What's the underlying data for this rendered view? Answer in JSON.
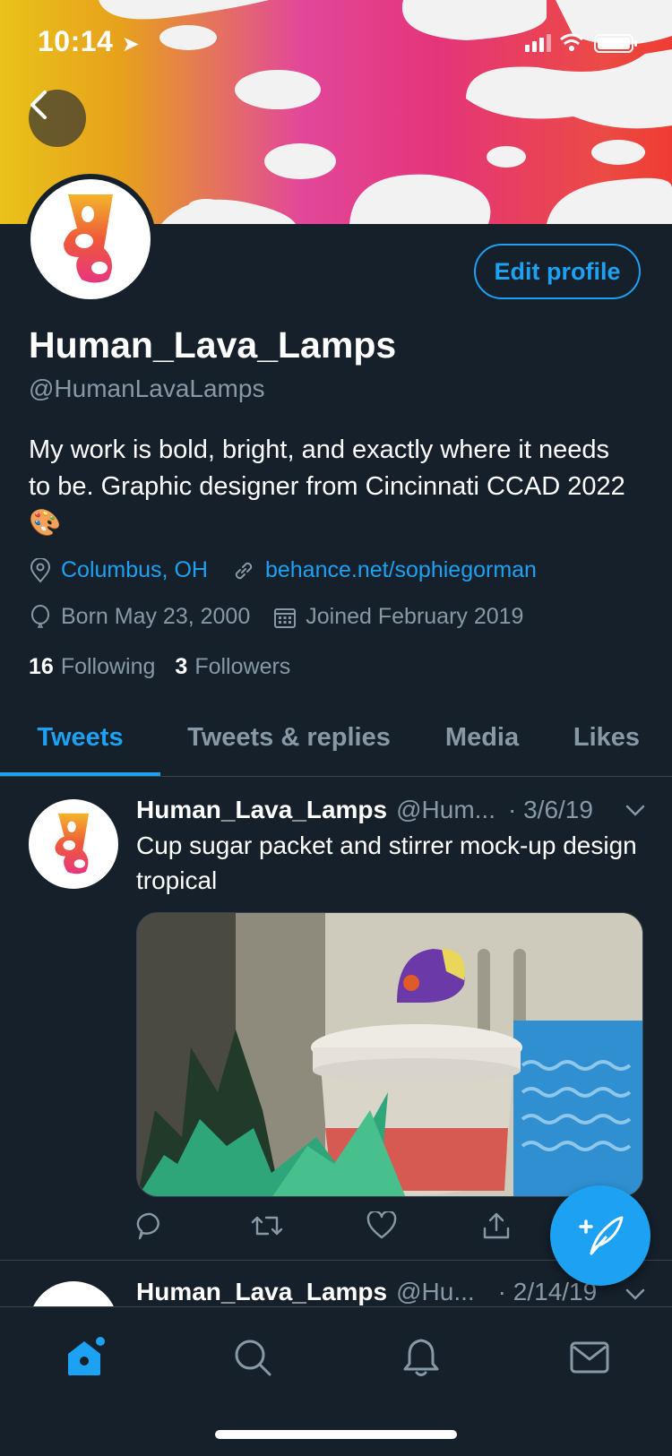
{
  "status_bar": {
    "time": "10:14"
  },
  "profile": {
    "display_name": "Human_Lava_Lamps",
    "handle": "@HumanLavaLamps",
    "bio": "My work is bold, bright, and exactly where it needs to be. Graphic designer from Cincinnati CCAD 2022🎨",
    "location": "Columbus, OH",
    "website": "behance.net/sophiegorman",
    "born": "Born May 23, 2000",
    "joined": "Joined February 2019",
    "following_count": "16",
    "following_label": "Following",
    "followers_count": "3",
    "followers_label": "Followers",
    "edit_label": "Edit profile"
  },
  "tabs": [
    {
      "label": "Tweets",
      "active": true
    },
    {
      "label": "Tweets & replies"
    },
    {
      "label": "Media"
    },
    {
      "label": "Likes"
    }
  ],
  "tweets": [
    {
      "name": "Human_Lava_Lamps",
      "handle": "@Hum...",
      "date": "· 3/6/19",
      "text": "Cup sugar packet and stirrer mock-up design tropical"
    },
    {
      "name": "Human_Lava_Lamps",
      "handle": "@Hu...",
      "date": "· 2/14/19"
    }
  ],
  "colors": {
    "accent": "#1da1f2",
    "background": "#15202b",
    "muted": "#8899a6",
    "divider": "#38444d"
  },
  "icons": {
    "nav": [
      "home-icon",
      "search-icon",
      "bell-icon",
      "mail-icon"
    ],
    "actions": [
      "reply-icon",
      "retweet-icon",
      "like-icon",
      "share-icon"
    ]
  }
}
